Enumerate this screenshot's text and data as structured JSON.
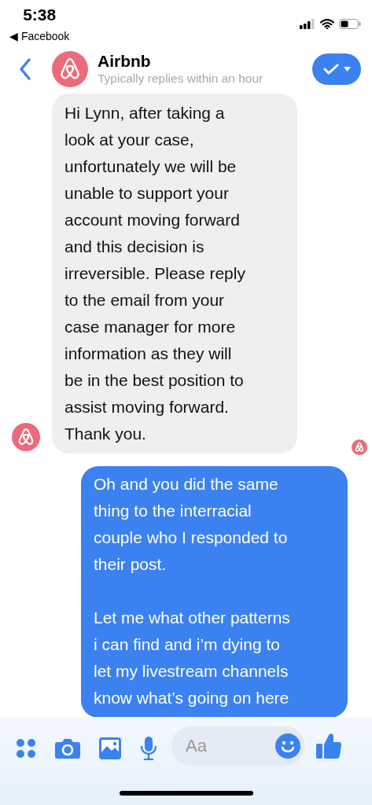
{
  "status_bar": {
    "time": "5:38",
    "back_app": "◀ Facebook"
  },
  "header": {
    "name": "Airbnb",
    "subtitle": "Typically replies within an hour"
  },
  "messages": [
    {
      "kind": "incoming",
      "text": "Hi Lynn, after taking a\nlook at your case,\nunfortunately we will be\nunable to support your\naccount moving forward\nand this decision is\nirreversible. Please reply\nto the email from your\ncase manager for more\ninformation as they will\nbe in the best position to\nassist moving forward.\nThank you."
    },
    {
      "kind": "outgoing",
      "text": "Oh and you did the same\nthing to the interracial\ncouple who I responded to\ntheir post.\n\nLet me what other patterns\ni can find and i’m dying to\nlet my livestream channels\nknow what’s going on here"
    }
  ],
  "composer": {
    "placeholder": "Aa"
  }
}
